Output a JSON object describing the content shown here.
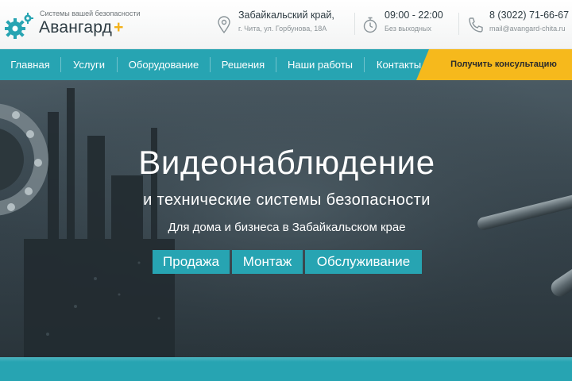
{
  "header": {
    "logo": {
      "tagline": "Системы вашей безопасности",
      "name": "Авангард",
      "plus": "+",
      "gear_color": "#27a4b2",
      "plus_color": "#f4b21a"
    },
    "address": {
      "icon": "map-pin-icon",
      "region": "Забайкальский край,",
      "street": "г. Чита, ул. Горбунова, 18А"
    },
    "hours": {
      "icon": "stopwatch-icon",
      "time": "09:00 - 22:00",
      "note": "Без выходных"
    },
    "contact": {
      "icon": "phone-icon",
      "phone": "8 (3022) 71-66-67",
      "email": "mail@avangard-chita.ru"
    }
  },
  "nav": {
    "items": [
      "Главная",
      "Услуги",
      "Оборудование",
      "Решения",
      "Наши работы",
      "Контакты"
    ],
    "cta": "Получить консультацию",
    "color": "#27a4b2",
    "cta_color": "#f6b91c"
  },
  "hero": {
    "title": "Видеонаблюдение",
    "subtitle": "и технические системы безопасности",
    "tagline": "Для дома и бизнеса в Забайкальском крае",
    "buttons": [
      "Продажа",
      "Монтаж",
      "Обслуживание"
    ]
  }
}
